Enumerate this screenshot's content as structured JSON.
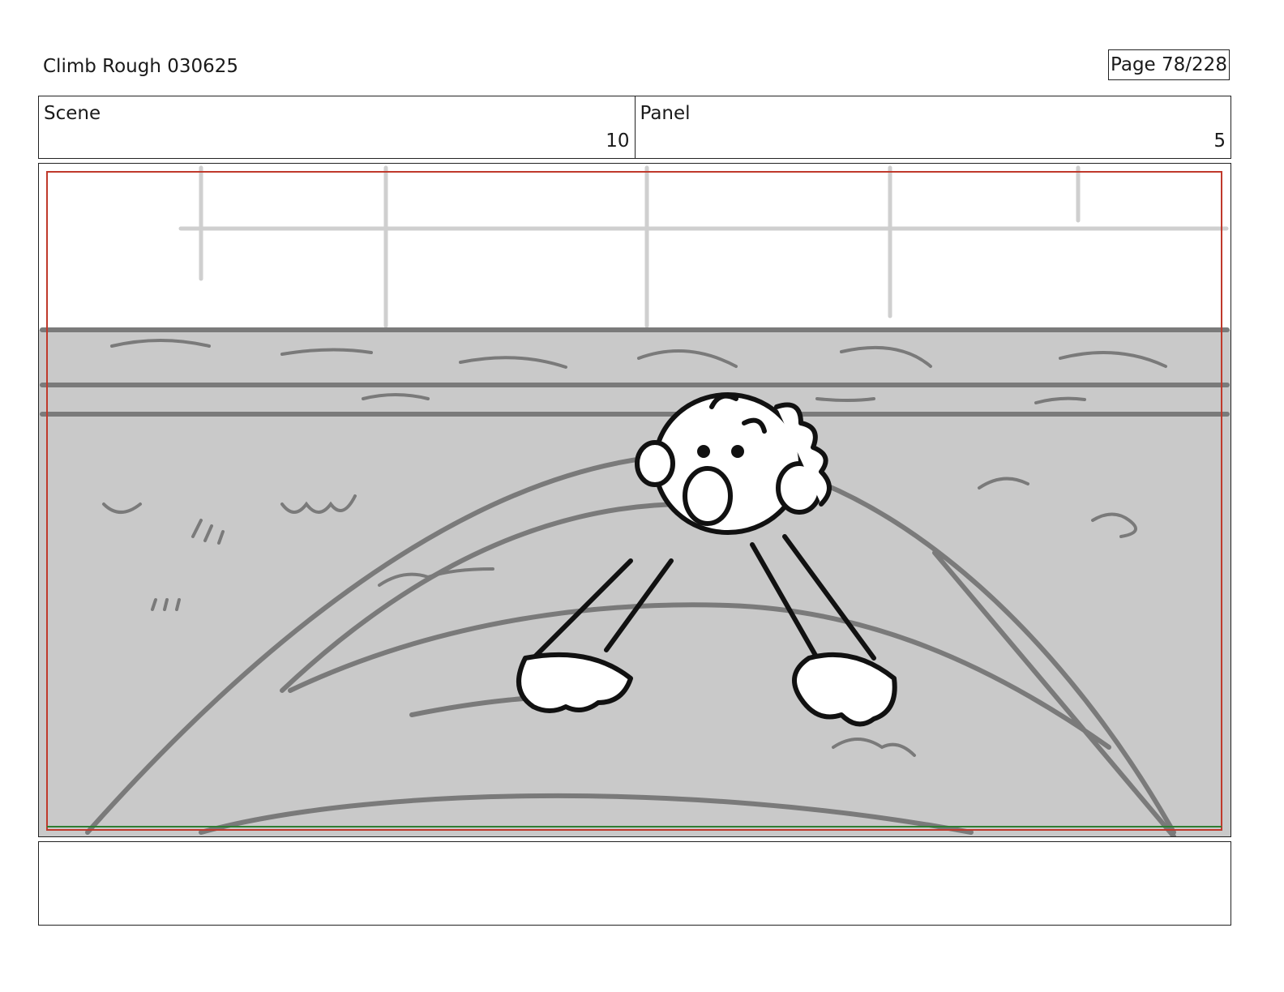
{
  "header": {
    "title": "Climb Rough 030625",
    "page_label": "Page",
    "page_value": "78/228"
  },
  "info": {
    "scene_label": "Scene",
    "scene_value": "10",
    "panel_label": "Panel",
    "panel_value": "5"
  },
  "notes": {
    "text": ""
  },
  "colors": {
    "safe_frame": "#c0392b",
    "bottom_guide": "#2e7d32",
    "sketch_gray": "#7a7a7a",
    "fill_gray": "#c9c9c9"
  }
}
